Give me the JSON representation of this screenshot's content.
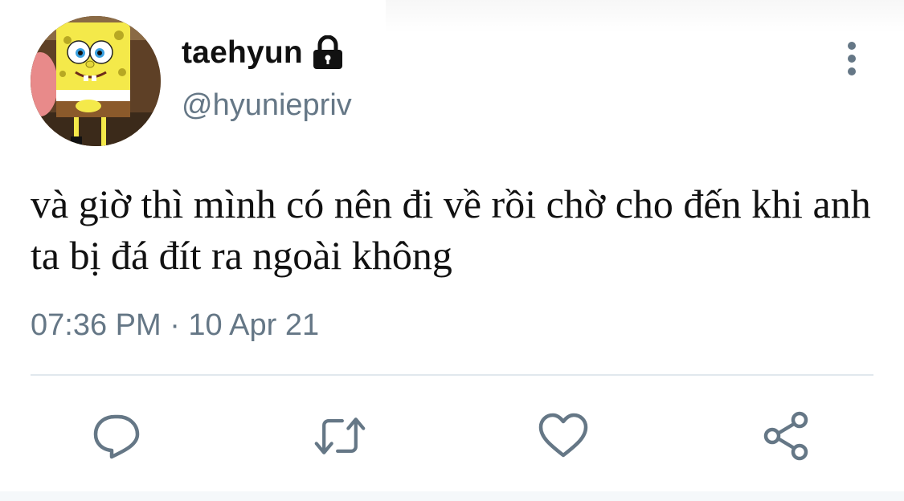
{
  "user": {
    "display_name": "taehyun",
    "handle": "@hyuniepriv",
    "protected_icon": "lock-icon",
    "avatar": "spongebob-avatar"
  },
  "tweet": {
    "text": "và giờ thì mình có nên đi về rồi chờ cho đến khi anh ta bị đá đít ra ngoài không",
    "timestamp": "07:36 PM · 10 Apr 21"
  },
  "actions": [
    {
      "name": "reply",
      "icon": "reply-icon"
    },
    {
      "name": "retweet",
      "icon": "retweet-icon"
    },
    {
      "name": "like",
      "icon": "heart-icon"
    },
    {
      "name": "share",
      "icon": "share-icon"
    }
  ],
  "menu_icon": "more-vertical-icon",
  "colors": {
    "text": "#111111",
    "secondary": "#657786",
    "divider": "#e1e8ed",
    "icon": "#657786"
  }
}
